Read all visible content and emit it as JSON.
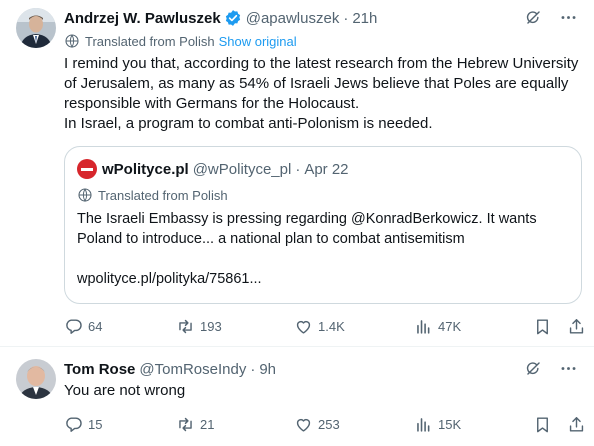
{
  "tweet1": {
    "author_name": "Andrzej W. Pawluszek",
    "handle": "@apawluszek",
    "separator": "·",
    "time": "21h",
    "translated_label": "Translated from Polish",
    "show_original": "Show original",
    "lines": [
      "I remind you that, according to the latest research from the Hebrew University",
      "of Jerusalem, as many as 54% of Israeli Jews believe that Poles are equally",
      "responsible with Germans for the Holocaust.",
      "In Israel, a program to combat anti-Polonism is needed."
    ],
    "quote": {
      "author_name": "wPolityce.pl",
      "handle": "@wPolityce_pl",
      "separator": "·",
      "date": "Apr 22",
      "translated_label": "Translated from Polish",
      "lines": [
        "The Israeli Embassy is pressing regarding @KonradBerkowicz. It wants",
        "Poland to introduce... a national plan to combat antisemitism"
      ],
      "link": "wpolityce.pl/polityka/75861..."
    },
    "stats": {
      "replies": "64",
      "retweets": "193",
      "likes": "1.4K",
      "views": "47K"
    }
  },
  "tweet2": {
    "author_name": "Tom Rose",
    "handle": "@TomRoseIndy",
    "separator": "·",
    "time": "9h",
    "text": "You are not wrong",
    "stats": {
      "replies": "15",
      "retweets": "21",
      "likes": "253",
      "views": "15K"
    }
  },
  "icons": {
    "verified": "verified-badge-icon",
    "grok": "grok-icon",
    "more": "more-icon",
    "translate": "globe-translate-icon",
    "reply": "reply-icon",
    "retweet": "retweet-icon",
    "like": "heart-icon",
    "views": "views-chart-icon",
    "bookmark": "bookmark-icon",
    "share": "share-icon"
  },
  "colors": {
    "accent": "#1d9bf0",
    "text": "#0f1419",
    "muted": "#536471",
    "border": "#cfd9de",
    "quote_logo": "#d7262c"
  }
}
